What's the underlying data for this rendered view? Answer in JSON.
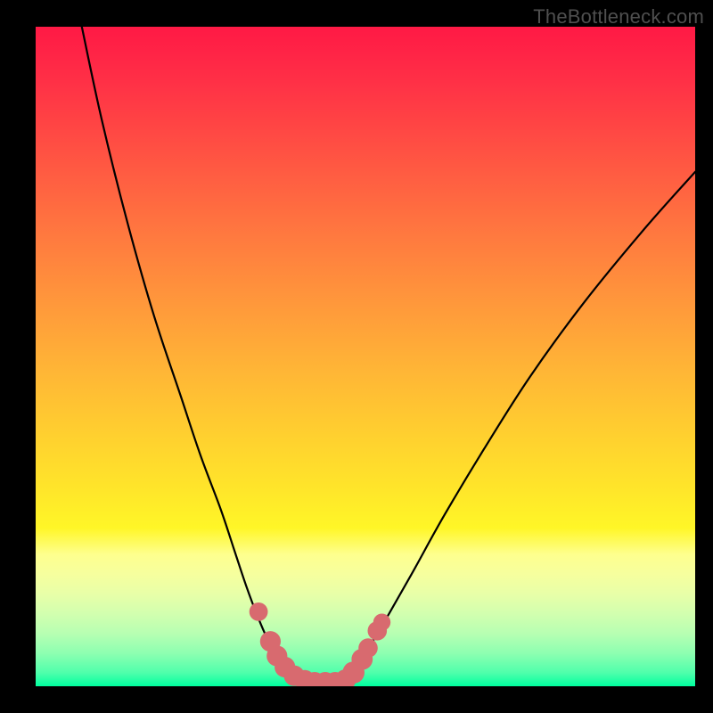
{
  "watermark": "TheBottleneck.com",
  "chart_data": {
    "type": "line",
    "title": "",
    "xlabel": "",
    "ylabel": "",
    "xlim": [
      0,
      100
    ],
    "ylim": [
      0,
      100
    ],
    "series": [
      {
        "name": "bottleneck-curve",
        "x": [
          7,
          10,
          14,
          18,
          22,
          25,
          28,
          30,
          32,
          33.5,
          35,
          36.5,
          38,
          39.5,
          41,
          43,
          45,
          46.5,
          48,
          50,
          53,
          57,
          62,
          68,
          75,
          83,
          92,
          100
        ],
        "y": [
          100,
          86,
          70,
          56,
          44,
          35,
          27,
          21,
          15,
          11,
          7.5,
          5,
          3,
          1.5,
          0.7,
          0.3,
          0.3,
          0.8,
          2,
          5,
          10,
          17,
          26,
          36,
          47,
          58,
          69,
          78
        ]
      }
    ],
    "markers": {
      "name": "highlight-points",
      "color": "#d86a6f",
      "points": [
        {
          "x": 33.8,
          "y": 11.3,
          "r": 1.2
        },
        {
          "x": 35.6,
          "y": 6.8,
          "r": 1.5
        },
        {
          "x": 36.6,
          "y": 4.6,
          "r": 1.5
        },
        {
          "x": 37.8,
          "y": 2.9,
          "r": 1.5
        },
        {
          "x": 39.2,
          "y": 1.6,
          "r": 1.5
        },
        {
          "x": 40.8,
          "y": 0.9,
          "r": 1.5
        },
        {
          "x": 42.3,
          "y": 0.6,
          "r": 1.5
        },
        {
          "x": 43.9,
          "y": 0.6,
          "r": 1.5
        },
        {
          "x": 45.4,
          "y": 0.6,
          "r": 1.5
        },
        {
          "x": 47.0,
          "y": 1.0,
          "r": 1.5
        },
        {
          "x": 48.2,
          "y": 2.1,
          "r": 1.7
        },
        {
          "x": 49.5,
          "y": 4.1,
          "r": 1.6
        },
        {
          "x": 50.4,
          "y": 5.8,
          "r": 1.3
        },
        {
          "x": 51.8,
          "y": 8.4,
          "r": 1.3
        },
        {
          "x": 52.5,
          "y": 9.7,
          "r": 1.0
        }
      ]
    },
    "gradient_stops": [
      {
        "pos": 0,
        "color": "#ff1945"
      },
      {
        "pos": 50,
        "color": "#ffb536"
      },
      {
        "pos": 75,
        "color": "#fff627"
      },
      {
        "pos": 100,
        "color": "#00ff9f"
      }
    ]
  }
}
